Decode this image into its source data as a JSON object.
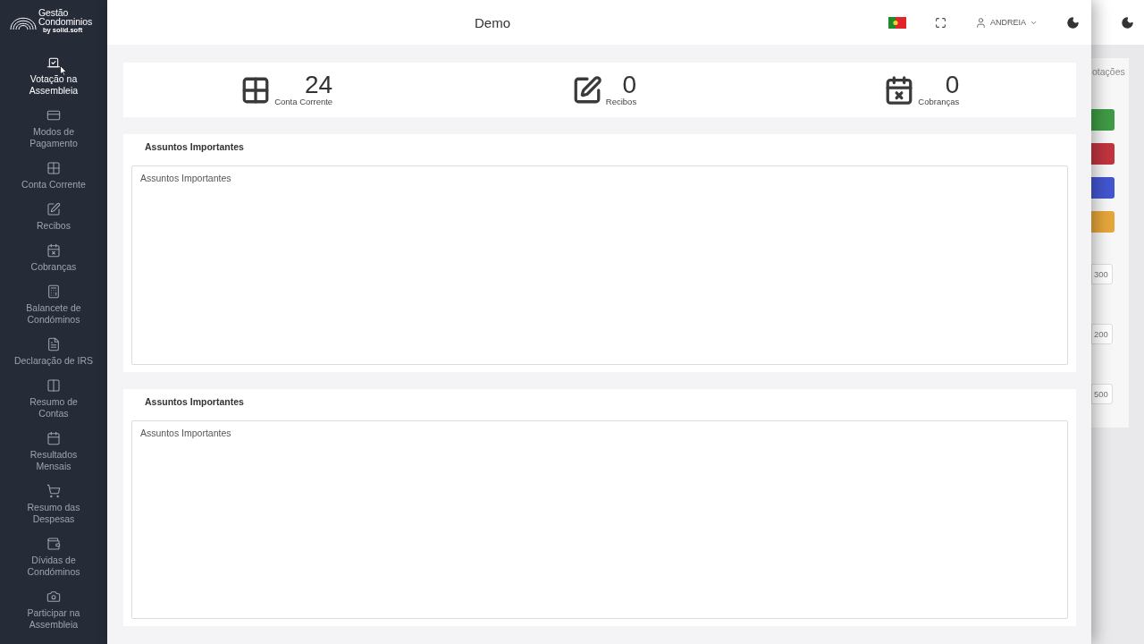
{
  "sidebar": {
    "logo": {
      "line_1": "Gestão",
      "line_2": "Condominios",
      "tagline": "by solid.soft"
    },
    "items": [
      {
        "label": "Votação na\nAssembleia",
        "selected": true
      },
      {
        "label": "Modos de\nPagamento",
        "selected": false
      },
      {
        "label": "Conta Corrente",
        "selected": false
      },
      {
        "label": "Recibos",
        "selected": false
      },
      {
        "label": "Cobranças",
        "selected": false
      },
      {
        "label": "Balancete de\nCondóminos",
        "selected": false
      },
      {
        "label": "Declaração de IRS",
        "selected": false
      },
      {
        "label": "Resumo de\nContas",
        "selected": false
      },
      {
        "label": "Resultados\nMensais",
        "selected": false
      },
      {
        "label": "Resumo das\nDespesas",
        "selected": false
      },
      {
        "label": "Dívidas de\nCondóminos",
        "selected": false
      },
      {
        "label": "Participar na\nAssembleia",
        "selected": false
      }
    ]
  },
  "header": {
    "title": "Demo",
    "user": "ANDREIA"
  },
  "stats": [
    {
      "value": "24",
      "label": "Conta Corrente"
    },
    {
      "value": "0",
      "label": "Recibos"
    },
    {
      "value": "0",
      "label": "Cobranças"
    }
  ],
  "panels": [
    {
      "title": "Assuntos Importantes",
      "field": {
        "value": "Assuntos Importantes"
      }
    },
    {
      "title": "Assuntos Importantes",
      "field": {
        "value": "Assuntos Importantes"
      }
    }
  ],
  "background_page": {
    "heading": "otações",
    "buttons": [
      {
        "color": "#3f9a45"
      },
      {
        "color": "#c0343f"
      },
      {
        "color": "#4256d0"
      },
      {
        "color": "#e5a53a"
      }
    ],
    "fields": [
      "300",
      "200",
      "500"
    ]
  }
}
